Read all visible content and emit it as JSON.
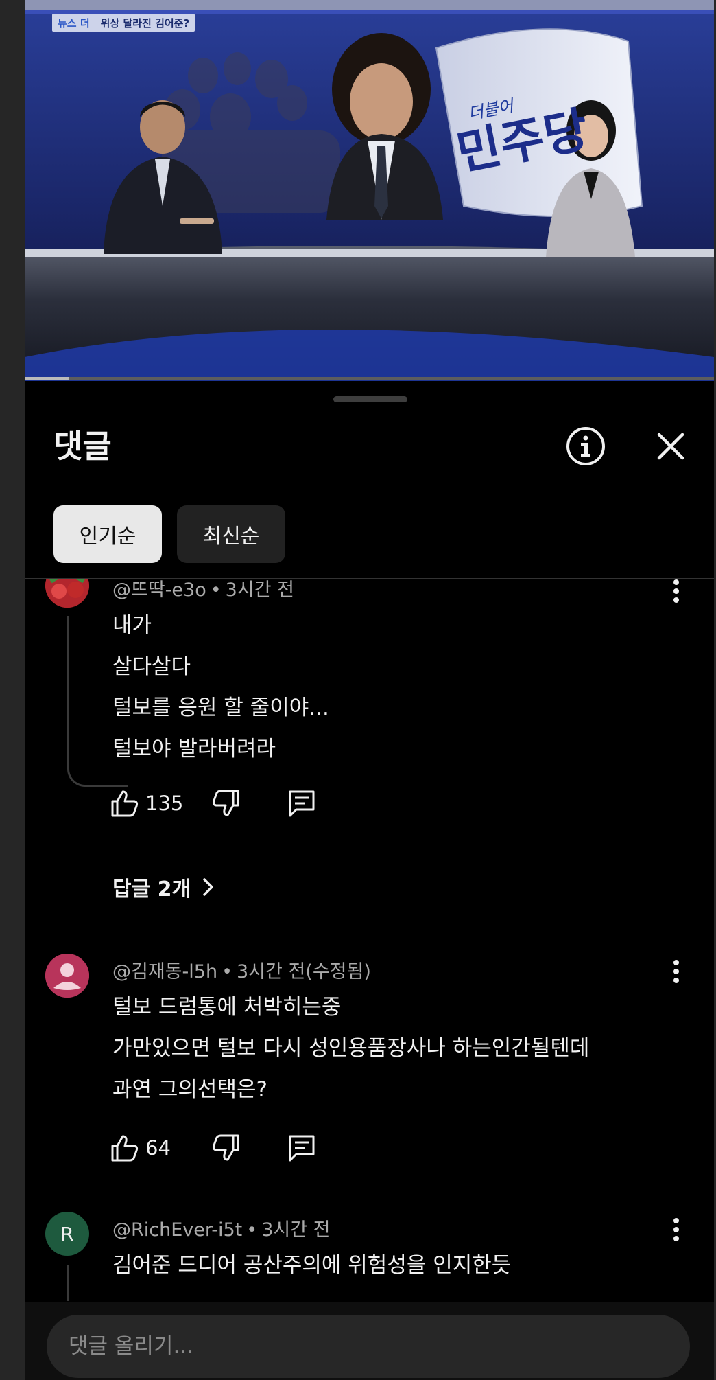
{
  "video": {
    "news_tag": "뉴스 더",
    "headline": "위상 달라진 김어준?",
    "backdrop_text_small": "더불어",
    "backdrop_text_large": "민주당",
    "progress_fraction": 0.065
  },
  "sheet": {
    "title": "댓글",
    "info_icon": "info-icon",
    "close_icon": "close-icon",
    "sort_chips": [
      {
        "label": "인기순",
        "selected": true
      },
      {
        "label": "최신순",
        "selected": false
      }
    ]
  },
  "comments": [
    {
      "author": "@뜨딱-e3o",
      "time": "3시간 전",
      "lines": [
        "내가",
        "살다살다",
        "털보를 응원 할 줄이야...",
        "털보야 발라버려라"
      ],
      "likes": "135",
      "replies_label": "답글 2개",
      "avatar_color": "#b3262d"
    },
    {
      "author": "@김재동-l5h",
      "time": "3시간 전(수정됨)",
      "lines": [
        "털보 드럼통에 처박히는중",
        "가만있으면 털보 다시 성인용품장사나 하는인간될텐데",
        "과연 그의선택은?"
      ],
      "likes": "64",
      "avatar_color": "#b8345b"
    },
    {
      "author": "@RichEver-i5t",
      "time": "3시간 전",
      "lines": [
        "김어준 드디어 공산주의에 위험성을 인지한듯"
      ],
      "avatar_letter": "R",
      "avatar_color": "#1e5a3e"
    }
  ],
  "input": {
    "placeholder": "댓글 올리기..."
  },
  "colors": {
    "background": "#000000",
    "text_primary": "#f1f1f1",
    "text_secondary": "#aaaaaa",
    "chip_selected_bg": "#e8e8e8",
    "chip_bg": "#222222"
  },
  "icons": [
    "thumbs-up-icon",
    "thumbs-down-icon",
    "reply-icon",
    "more-vert-icon",
    "chevron-right-icon",
    "info-icon",
    "close-icon"
  ]
}
